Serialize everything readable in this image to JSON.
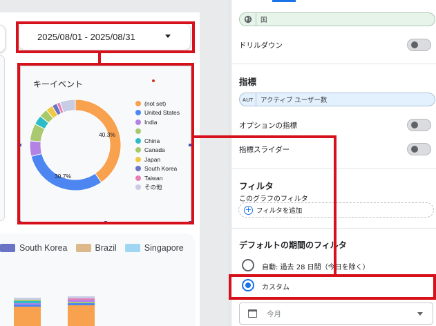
{
  "date_range": {
    "label": "2025/08/01 - 2025/08/31"
  },
  "chart": {
    "title": "キーイベント",
    "center_labels": {
      "slice_0": "40.3%",
      "slice_1": "30.7%"
    }
  },
  "chart_data": {
    "type": "pie",
    "donut": true,
    "title": "キーイベント",
    "categories": [
      "(not set)",
      "United States",
      "India",
      "",
      "China",
      "Canada",
      "Japan",
      "South Korea",
      "Taiwan",
      "その他"
    ],
    "values": [
      40.3,
      30.7,
      5.5,
      6.2,
      3.3,
      3.0,
      2.5,
      1.8,
      1.2,
      5.5
    ],
    "data_labels": [
      "40.3%",
      "30.7%"
    ],
    "colors": [
      "#f8a14e",
      "#4d86f1",
      "#b283e4",
      "#a9c870",
      "#2bbcc8",
      "#a7c96a",
      "#f1c845",
      "#6a74c4",
      "#e87fb6",
      "#c8cde6"
    ],
    "legend_position": "right"
  },
  "bottom_chart": {
    "legend": [
      {
        "label": "South Korea",
        "color": "#6a74c4"
      },
      {
        "label": "Brazil",
        "color": "#ddb88a"
      },
      {
        "label": "Singapore",
        "color": "#9fd6f4"
      }
    ]
  },
  "panel": {
    "dimension_chip": "国",
    "drilldown_label": "ドリルダウン",
    "metrics_title": "指標",
    "metric_chip_type": "AUT",
    "metric_chip": "アクティブ ユーザー数",
    "optional_metrics_label": "オプションの指標",
    "metric_slider_label": "指標スライダー",
    "filter_title": "フィルタ",
    "filter_subtitle": "このグラフのフィルタ",
    "add_filter_label": "フィルタを追加",
    "default_date_title": "デフォルトの期間のフィルタ",
    "auto_option": "自動: 過去 28 日間（今日を除く）",
    "custom_option": "カスタム",
    "period_select": "今月"
  },
  "colors": {
    "accent": "#1a73e8",
    "annotation_red": "#d7111b"
  }
}
